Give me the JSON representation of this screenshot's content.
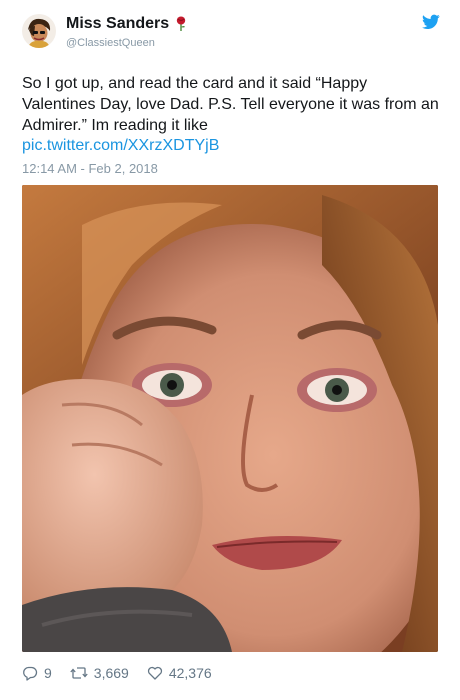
{
  "user": {
    "display_name": "Miss Sanders",
    "handle": "@ClassiestQueen"
  },
  "tweet": {
    "text": "So I got up, and read the card and it said “Happy Valentines Day, love Dad. P.S. Tell everyone it was from an Admirer.” Im reading it like",
    "link": "pic.twitter.com/XXrzXDTYjB",
    "timestamp": "12:14 AM - Feb 2, 2018"
  },
  "actions": {
    "replies": "9",
    "retweets": "3,669",
    "likes": "42,376"
  },
  "colors": {
    "link": "#1b95e0",
    "muted": "#8899a6",
    "twitter_blue": "#1da1f2"
  }
}
